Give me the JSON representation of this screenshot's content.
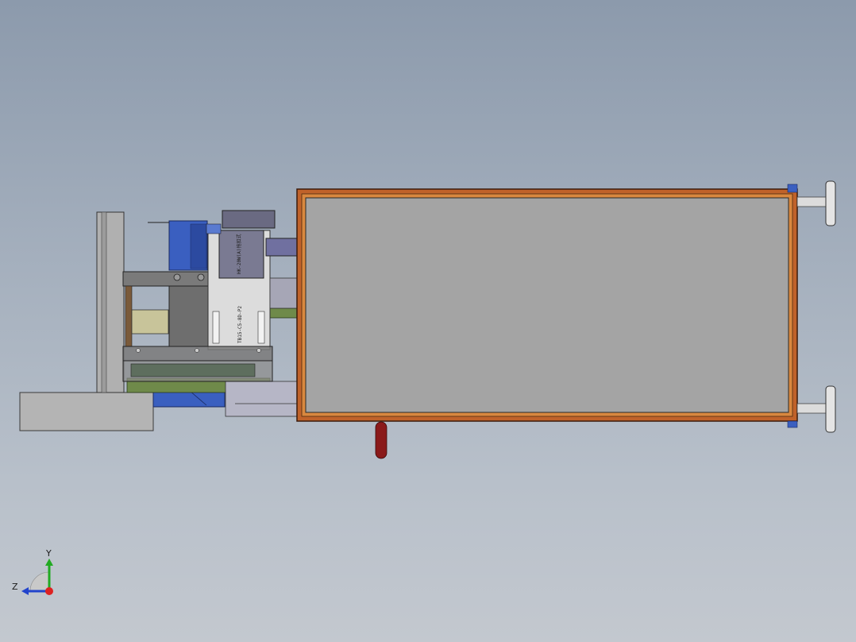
{
  "colors": {
    "background_top": "#8c9aac",
    "background_bottom": "#c3c8cf",
    "frame_orange": "#c0622a",
    "panel_gray": "#a4a4a4",
    "motor_blue": "#3a5fc0",
    "handle_red": "#8a1a1a",
    "plate_gray": "#b4b4b4",
    "valve_purple": "#6a6a82",
    "base_green": "#6f8a4a",
    "axis_y": "#22aa22",
    "axis_z": "#2244cc",
    "axis_origin": "#dd2222"
  },
  "triad": {
    "y_label": "Y",
    "z_label": "Z"
  },
  "part_labels": {
    "valve_label_1": "HK-20W(A)拖扣式",
    "valve_label_2": "TB15-C5-8D-P2"
  }
}
